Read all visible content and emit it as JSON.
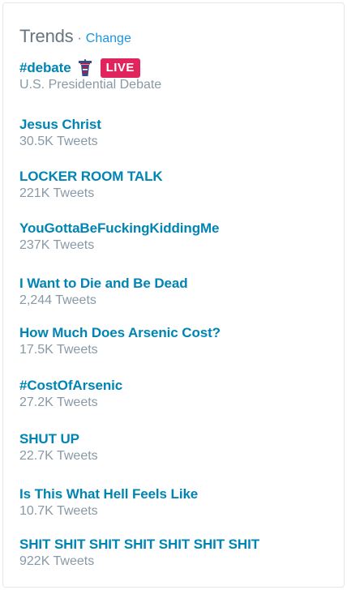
{
  "header": {
    "title": "Trends",
    "separator": "·",
    "change_label": "Change"
  },
  "trends": [
    {
      "name": "#debate",
      "meta": "U.S. Presidential Debate",
      "icon": "debate-podium-icon",
      "badge": "LIVE"
    },
    {
      "name": "Jesus Christ",
      "meta": "30.5K Tweets"
    },
    {
      "name": "LOCKER ROOM TALK",
      "meta": "221K Tweets"
    },
    {
      "name": "YouGottaBeFuckingKiddingMe",
      "meta": "237K Tweets"
    },
    {
      "name": "I Want to Die and Be Dead",
      "meta": "2,244 Tweets"
    },
    {
      "name": "How Much Does Arsenic Cost?",
      "meta": "17.5K Tweets"
    },
    {
      "name": "#CostOfArsenic",
      "meta": "27.2K Tweets"
    },
    {
      "name": "SHUT UP",
      "meta": "22.7K Tweets"
    },
    {
      "name": "Is This What Hell Feels Like",
      "meta": "10.7K Tweets"
    },
    {
      "name": "SHIT SHIT SHIT SHIT SHIT SHIT SHIT",
      "meta": "922K Tweets"
    }
  ],
  "colors": {
    "link": "#0084b4",
    "meta": "#8899a6",
    "live_badge": "#e0245e",
    "title": "#66757f"
  }
}
